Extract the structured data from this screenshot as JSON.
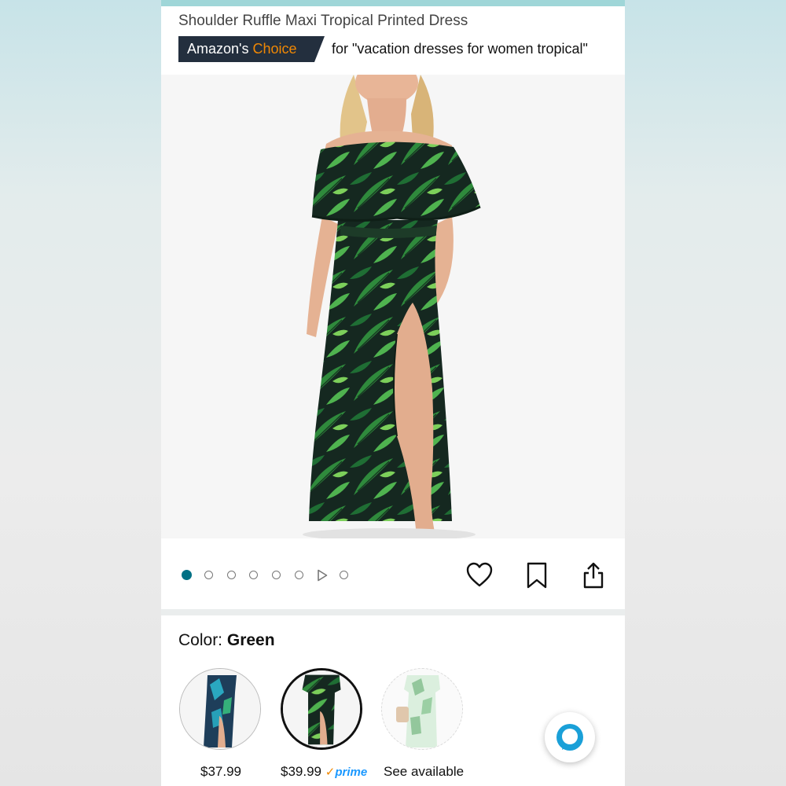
{
  "product": {
    "title": "Shoulder Ruffle Maxi Tropical Printed Dress",
    "badge_prefix": "Amazon's",
    "badge_highlight": "Choice",
    "badge_context": "for \"vacation dresses for women tropical\""
  },
  "carousel": {
    "total_items": 8,
    "active_index": 0,
    "video_index": 6
  },
  "actions": {
    "favorite_icon": "heart-icon",
    "save_icon": "bookmark-icon",
    "share_icon": "share-icon"
  },
  "color": {
    "label": "Color:",
    "selected": "Green"
  },
  "variants": [
    {
      "price": "$37.99",
      "prime": false
    },
    {
      "price": "$39.99",
      "prime": true,
      "prime_check": "✓",
      "prime_label": "prime"
    },
    {
      "price": "See available",
      "prime": false
    }
  ],
  "colors": {
    "amazon_dark": "#232f3e",
    "amazon_orange": "#f08804",
    "teal_accent": "#007185",
    "prime_blue": "#1a98ff",
    "alexa_ring": "#1aa0d8"
  }
}
